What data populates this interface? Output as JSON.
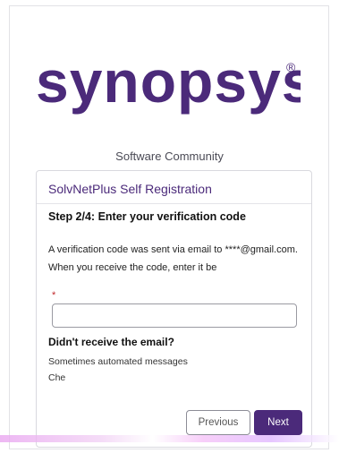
{
  "brand": {
    "logo_text": "synopsys",
    "logo_color": "#4b2a7a",
    "registered_mark": "®",
    "subtitle": "Software Community"
  },
  "card": {
    "title": "SolvNetPlus Self Registration",
    "step_title": "Step 2/4: Enter your verification code",
    "message_line1": "A verification code was sent via email to       ****@gmail.com.",
    "message_line2": "When you receive the code, enter it be",
    "required_marker": "*",
    "code_input": {
      "value": "",
      "placeholder": ""
    },
    "resend_title": "Didn't receive the email?",
    "resend_line1": "Sometimes automated messages",
    "resend_line2": "Che"
  },
  "buttons": {
    "previous_label": "Previous",
    "next_label": "Next"
  },
  "colors": {
    "accent": "#4b2a7a",
    "required": "#c0282b"
  }
}
